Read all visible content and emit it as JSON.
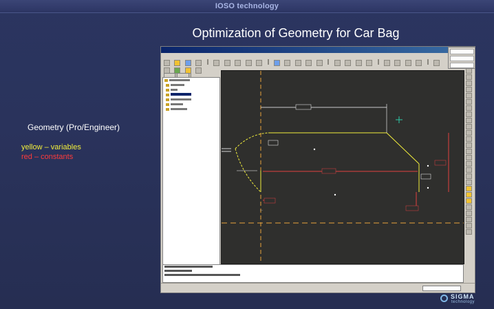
{
  "header": {
    "title": "IOSO technology"
  },
  "slide": {
    "title": "Optimization of  Geometry for Car Bag",
    "geometry_label": "Geometry (Pro/Engineer)",
    "legend": {
      "yellow": "yellow – variables",
      "red": "red – constants"
    }
  },
  "colors": {
    "variables": "#f2ee3c",
    "constants": "#ff3b3b",
    "canvas": "#2f2f2d",
    "background": "#2a335c"
  },
  "proe": {
    "window_title": "",
    "menu_items": [],
    "tree_tabs": [],
    "tree_items": [],
    "messages": [],
    "status_label": "",
    "status_value": ""
  },
  "logo": {
    "name": "SIGMA",
    "sub": "technology"
  }
}
